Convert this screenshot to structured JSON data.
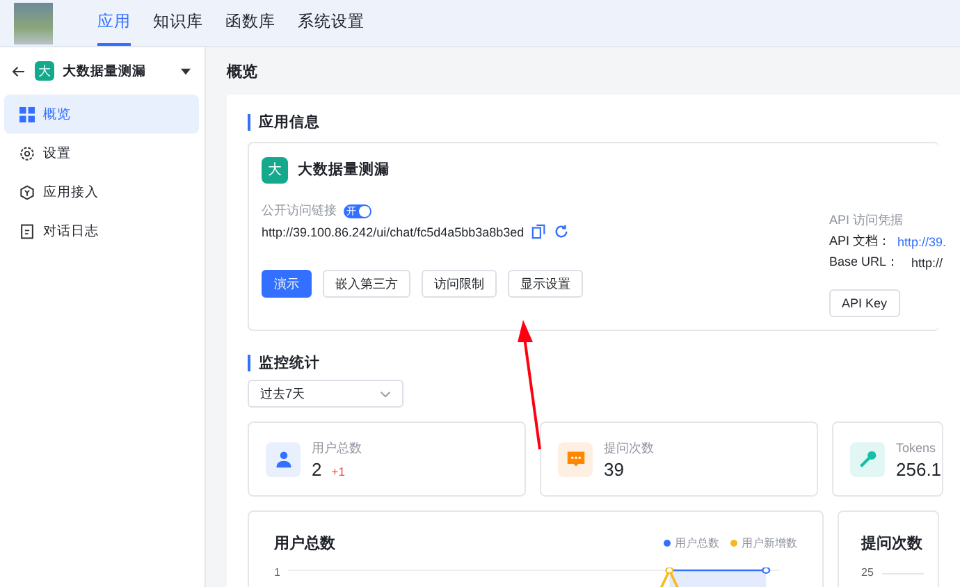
{
  "top_nav": {
    "tabs": [
      {
        "label": "应用",
        "selected": true
      },
      {
        "label": "知识库",
        "selected": false
      },
      {
        "label": "函数库",
        "selected": false
      },
      {
        "label": "系统设置",
        "selected": false
      }
    ]
  },
  "sidebar": {
    "app_avatar": "大",
    "app_name": "大数据量测漏",
    "items": [
      {
        "label": "概览",
        "kind": "grid",
        "selected": true
      },
      {
        "label": "设置",
        "kind": "gear",
        "selected": false
      },
      {
        "label": "应用接入",
        "kind": "hex",
        "selected": false
      },
      {
        "label": "对话日志",
        "kind": "doc",
        "selected": false
      }
    ]
  },
  "page_title": "概览",
  "app_info": {
    "title": "应用信息",
    "avatar": "大",
    "name": "大数据量测漏",
    "public_link_label": "公开访问链接",
    "public_link_on": true,
    "switch_text": "开",
    "url": "http://39.100.86.242/ui/chat/fc5d4a5bb3a8b3ed",
    "buttons": [
      {
        "label": "演示",
        "primary": true
      },
      {
        "label": "嵌入第三方",
        "primary": false
      },
      {
        "label": "访问限制",
        "primary": false
      },
      {
        "label": "显示设置",
        "primary": false
      }
    ],
    "api_title": "API 访问凭据",
    "api_doc_label": "API 文档：",
    "api_doc_url": "http://39.",
    "base_url_label": "Base URL：",
    "base_url": "http://",
    "api_key_button": "API Key"
  },
  "monitoring": {
    "title": "监控统计",
    "range": "过去7天",
    "stats": [
      {
        "label": "用户总数",
        "value": "2",
        "delta": "+1",
        "kind": "user"
      },
      {
        "label": "提问次数",
        "value": "39",
        "kind": "chat"
      },
      {
        "label": "Tokens",
        "value": "256.1",
        "kind": "key"
      }
    ],
    "charts": [
      {
        "title": "用户总数",
        "tick": "1",
        "legend": [
          {
            "label": "用户总数",
            "color": "#3370ff"
          },
          {
            "label": "用户新增数",
            "color": "#f7ba1e"
          }
        ]
      },
      {
        "title": "提问次数",
        "tick": "25"
      }
    ]
  }
}
